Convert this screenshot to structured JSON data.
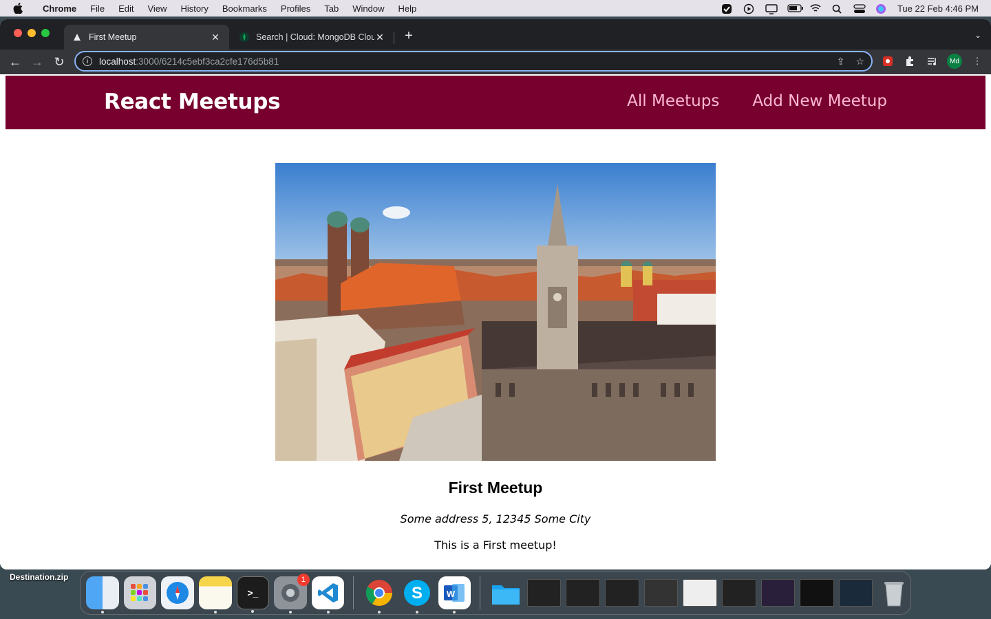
{
  "menubar": {
    "app_name": "Chrome",
    "items": [
      "File",
      "Edit",
      "View",
      "History",
      "Bookmarks",
      "Profiles",
      "Tab",
      "Window",
      "Help"
    ],
    "clock": "Tue 22 Feb  4:46 PM"
  },
  "browser": {
    "tabs": [
      {
        "title": "First Meetup",
        "active": true
      },
      {
        "title": "Search | Cloud: MongoDB Cloud",
        "active": false
      }
    ],
    "url_host": "localhost",
    "url_path": ":3000/6214c5ebf3ca2cfe176d5b81",
    "profile_initials": "Md"
  },
  "site": {
    "logo": "React Meetups",
    "nav": [
      "All Meetups",
      "Add New Meetup"
    ]
  },
  "meetup": {
    "title": "First Meetup",
    "address": "Some address 5, 12345 Some City",
    "description": "This is a First meetup!"
  },
  "desktop": {
    "file_label": "Destination.zip",
    "settings_badge": "1"
  },
  "colors": {
    "header_bg": "#77002e",
    "nav_link": "#fcb8d2"
  }
}
